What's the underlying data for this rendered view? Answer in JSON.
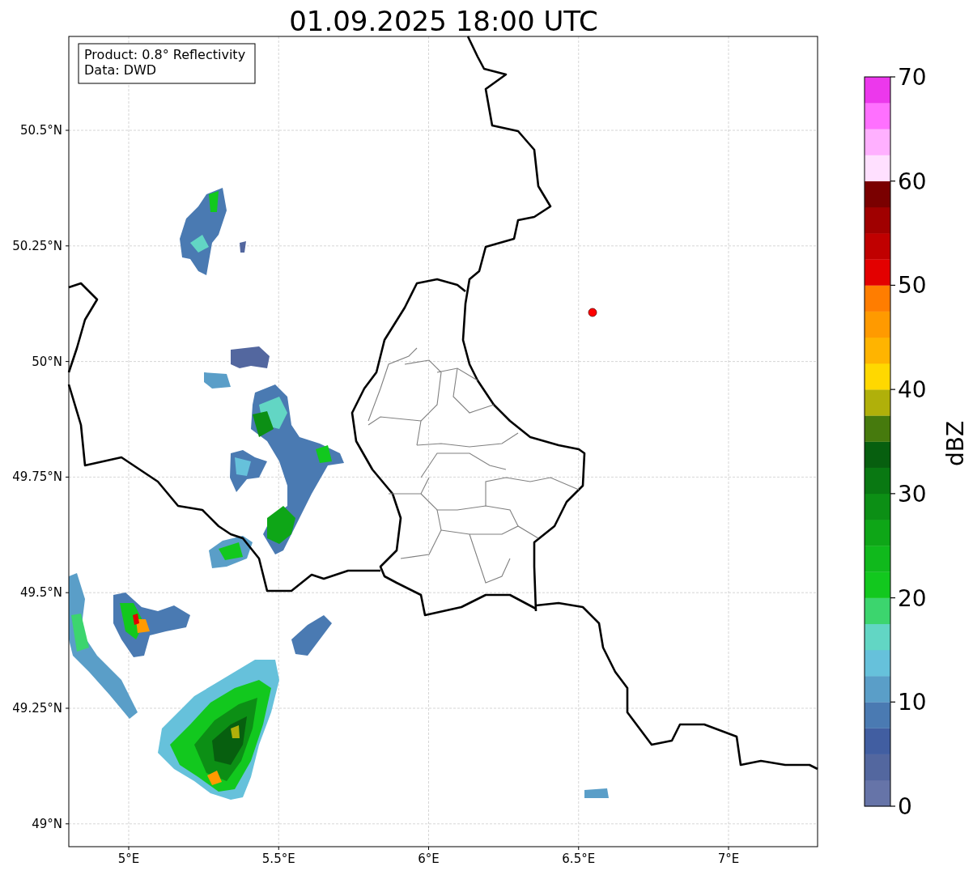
{
  "title": "01.09.2025 18:00 UTC",
  "legend": [
    "Product: 0.8° Reflectivity",
    "Data: DWD"
  ],
  "map": {
    "x_ticks": [
      "5°E",
      "5.5°E",
      "6°E",
      "6.5°E",
      "7°E"
    ],
    "y_ticks": [
      "50.5°N",
      "50.25°N",
      "50°N",
      "49.75°N",
      "49.5°N",
      "49.25°N",
      "49°N"
    ]
  },
  "colorbar": {
    "label": "dBZ",
    "ticks": [
      "70",
      "60",
      "50",
      "40",
      "30",
      "20",
      "10",
      "0"
    ],
    "bins": [
      {
        "color": "#6674a8"
      },
      {
        "color": "#53679f"
      },
      {
        "color": "#415ea1"
      },
      {
        "color": "#4a7ab2"
      },
      {
        "color": "#5a9ec8"
      },
      {
        "color": "#66c1db"
      },
      {
        "color": "#62d6c4"
      },
      {
        "color": "#3cd56e"
      },
      {
        "color": "#12c81e"
      },
      {
        "color": "#10b91c"
      },
      {
        "color": "#0ea617"
      },
      {
        "color": "#0c8f15"
      },
      {
        "color": "#097812"
      },
      {
        "color": "#075f0f"
      },
      {
        "color": "#467a0d"
      },
      {
        "color": "#b0b00a"
      },
      {
        "color": "#ffd800"
      },
      {
        "color": "#ffb400"
      },
      {
        "color": "#ff9a00"
      },
      {
        "color": "#ff7d00"
      },
      {
        "color": "#e30000"
      },
      {
        "color": "#c00000"
      },
      {
        "color": "#a00000"
      },
      {
        "color": "#7a0000"
      },
      {
        "color": "#ffe0ff"
      },
      {
        "color": "#ffb0ff"
      },
      {
        "color": "#ff70ff"
      },
      {
        "color": "#ec38ec"
      }
    ]
  }
}
